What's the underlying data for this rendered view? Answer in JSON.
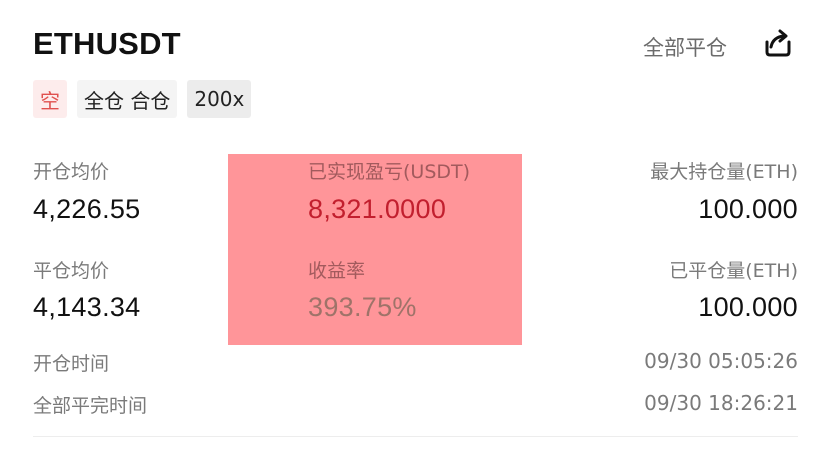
{
  "header": {
    "symbol": "ETHUSDT",
    "close_all_label": "全部平仓",
    "share_icon": "share-icon"
  },
  "tags": {
    "side": "空",
    "margin_mode": "全仓 合仓",
    "leverage": "200x"
  },
  "stats": {
    "open_avg_price_label": "开仓均价",
    "open_avg_price": "4,226.55",
    "close_avg_price_label": "平仓均价",
    "close_avg_price": "4,143.34",
    "realized_pnl_label": "已实现盈亏(USDT)",
    "realized_pnl": "8,321.0000",
    "roi_label": "收益率",
    "roi": "393.75%",
    "max_hold_label": "最大持仓量(ETH)",
    "max_hold": "100.000",
    "closed_qty_label": "已平仓量(ETH)",
    "closed_qty": "100.000"
  },
  "times": {
    "open_time_label": "开仓时间",
    "open_time": "09/30 05:05:26",
    "full_close_time_label": "全部平完时间",
    "full_close_time": "09/30 18:26:21"
  },
  "colors": {
    "short_tag_text": "#e0504e",
    "pnl_text": "#c21f2e",
    "highlight_overlay": "#ff9599"
  }
}
